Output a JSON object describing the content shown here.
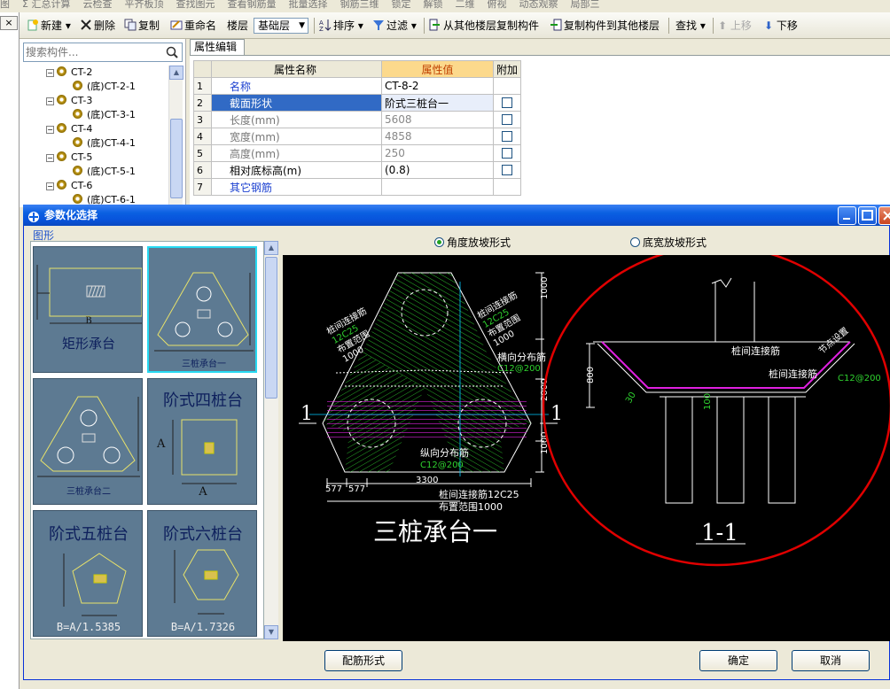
{
  "topbar": {
    "items": [
      "图",
      "Σ 汇总计算",
      "云检查",
      "平齐板顶",
      "查找图元",
      "查看钢筋量",
      "批量选择",
      "钢筋三维",
      "锁定",
      "解锁",
      "二维",
      "俯视",
      "动态观察",
      "局部三"
    ]
  },
  "toolbar": {
    "new_label": "新建",
    "delete_label": "删除",
    "copy_label": "复制",
    "rename_label": "重命名",
    "floor_label": "楼层",
    "floor_value": "基础层",
    "sort_label": "排序",
    "filter_label": "过滤",
    "copy_from_label": "从其他楼层复制构件",
    "copy_to_label": "复制构件到其他楼层",
    "find_label": "查找",
    "move_up_label": "上移",
    "move_down_label": "下移"
  },
  "left": {
    "close_label": "×"
  },
  "search": {
    "placeholder": "搜索构件..."
  },
  "tree": {
    "items": [
      {
        "label": "CT-2",
        "level": 0
      },
      {
        "label": "(底)CT-2-1",
        "level": 1
      },
      {
        "label": "CT-3",
        "level": 0
      },
      {
        "label": "(底)CT-3-1",
        "level": 1
      },
      {
        "label": "CT-4",
        "level": 0
      },
      {
        "label": "(底)CT-4-1",
        "level": 1
      },
      {
        "label": "CT-5",
        "level": 0
      },
      {
        "label": "(底)CT-5-1",
        "level": 1
      },
      {
        "label": "CT-6",
        "level": 0
      },
      {
        "label": "(底)CT-6-1",
        "level": 1
      }
    ]
  },
  "properties": {
    "tab_label": "属性编辑",
    "headers": {
      "name": "属性名称",
      "value": "属性值",
      "extra": "附加"
    },
    "rows": [
      {
        "num": "1",
        "name": "名称",
        "value": "CT-8-2",
        "has_check": false
      },
      {
        "num": "2",
        "name": "截面形状",
        "value": "阶式三桩台一",
        "has_check": true
      },
      {
        "num": "3",
        "name": "长度(mm)",
        "value": "5608",
        "has_check": true
      },
      {
        "num": "4",
        "name": "宽度(mm)",
        "value": "4858",
        "has_check": true
      },
      {
        "num": "5",
        "name": "高度(mm)",
        "value": "250",
        "has_check": true
      },
      {
        "num": "6",
        "name": "相对底标高(m)",
        "value": "(0.8)",
        "has_check": true
      },
      {
        "num": "7",
        "name": "其它钢筋",
        "value": "",
        "has_check": false
      }
    ]
  },
  "dialog": {
    "title": "参数化选择",
    "group_label": "图形",
    "radio_angle": "角度放坡形式",
    "radio_width": "底宽放坡形式",
    "rebar_button": "配筋形式",
    "ok_button": "确定",
    "cancel_button": "取消"
  },
  "thumbs": [
    {
      "label": "矩形承台",
      "sub": "B"
    },
    {
      "label": "三桩承台一",
      "sub": ""
    },
    {
      "label": "三桩承台二",
      "sub": ""
    },
    {
      "label": "阶式四桩台",
      "sub": "A"
    },
    {
      "label": "阶式五桩台",
      "sub": "B=A/1.5385"
    },
    {
      "label": "阶式六桩台",
      "sub": "B=A/1.7326"
    }
  ],
  "cad": {
    "plan_title": "三桩承台一",
    "section_title": "1-1",
    "section_mark": "1",
    "labels": {
      "link_rebar": "桩间连接筋",
      "link_spec": "12C25",
      "layout_range": "布置范围",
      "range_val": "1000",
      "horiz_dist": "横向分布筋",
      "horiz_spec": "C12@200",
      "long_dist": "纵向分布筋",
      "long_spec": "C12@200",
      "link_bottom": "桩间连接筋12C25",
      "range_bottom": "布置范围1000",
      "dim_1000": "1000",
      "dim_577": "577",
      "dim_3300": "3300",
      "dim_800": "800",
      "dim_100": "100",
      "dim_2000": "2000",
      "angle": "30",
      "sec_link": "桩间连接筋",
      "sec_spec": "C12@200",
      "sec_rot": "节点设置"
    }
  },
  "colors": {
    "accent": "#0a5fe1",
    "circle": "#e00000",
    "green": "#2fd12f",
    "magenta": "#e020e0"
  }
}
